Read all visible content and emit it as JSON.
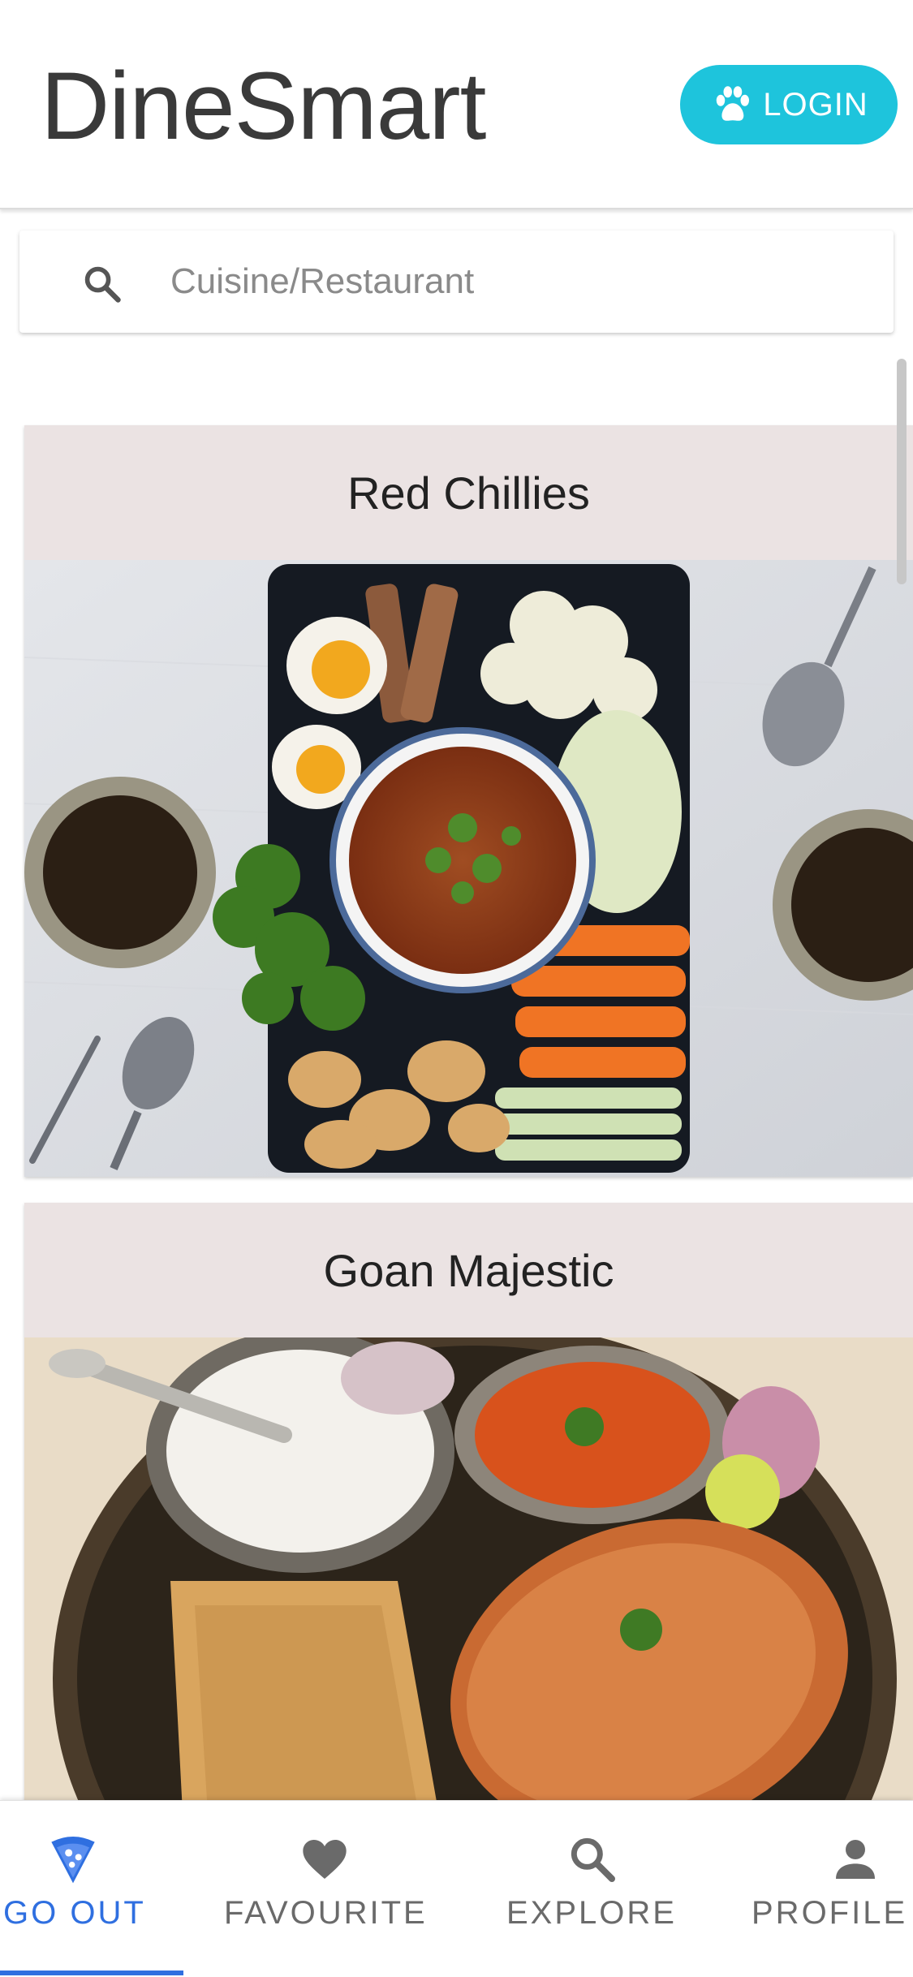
{
  "header": {
    "title": "DineSmart",
    "login_label": "LOGIN",
    "login_icon": "paw-icon",
    "login_color": "#1ec4dc"
  },
  "search": {
    "placeholder": "Cuisine/Restaurant",
    "value": "",
    "icon": "search-icon"
  },
  "restaurants": [
    {
      "name": "Red Chillies",
      "image": "food-platter-photo"
    },
    {
      "name": "Goan Majestic",
      "image": "thali-plate-photo"
    }
  ],
  "bottom_nav": {
    "active_color": "#2f6fe0",
    "items": [
      {
        "label": "GO OUT",
        "icon": "pizza-slice-icon",
        "active": true
      },
      {
        "label": "FAVOURITE",
        "icon": "heart-icon",
        "active": false
      },
      {
        "label": "EXPLORE",
        "icon": "search-icon",
        "active": false
      },
      {
        "label": "PROFILE",
        "icon": "person-icon",
        "active": false
      }
    ]
  }
}
